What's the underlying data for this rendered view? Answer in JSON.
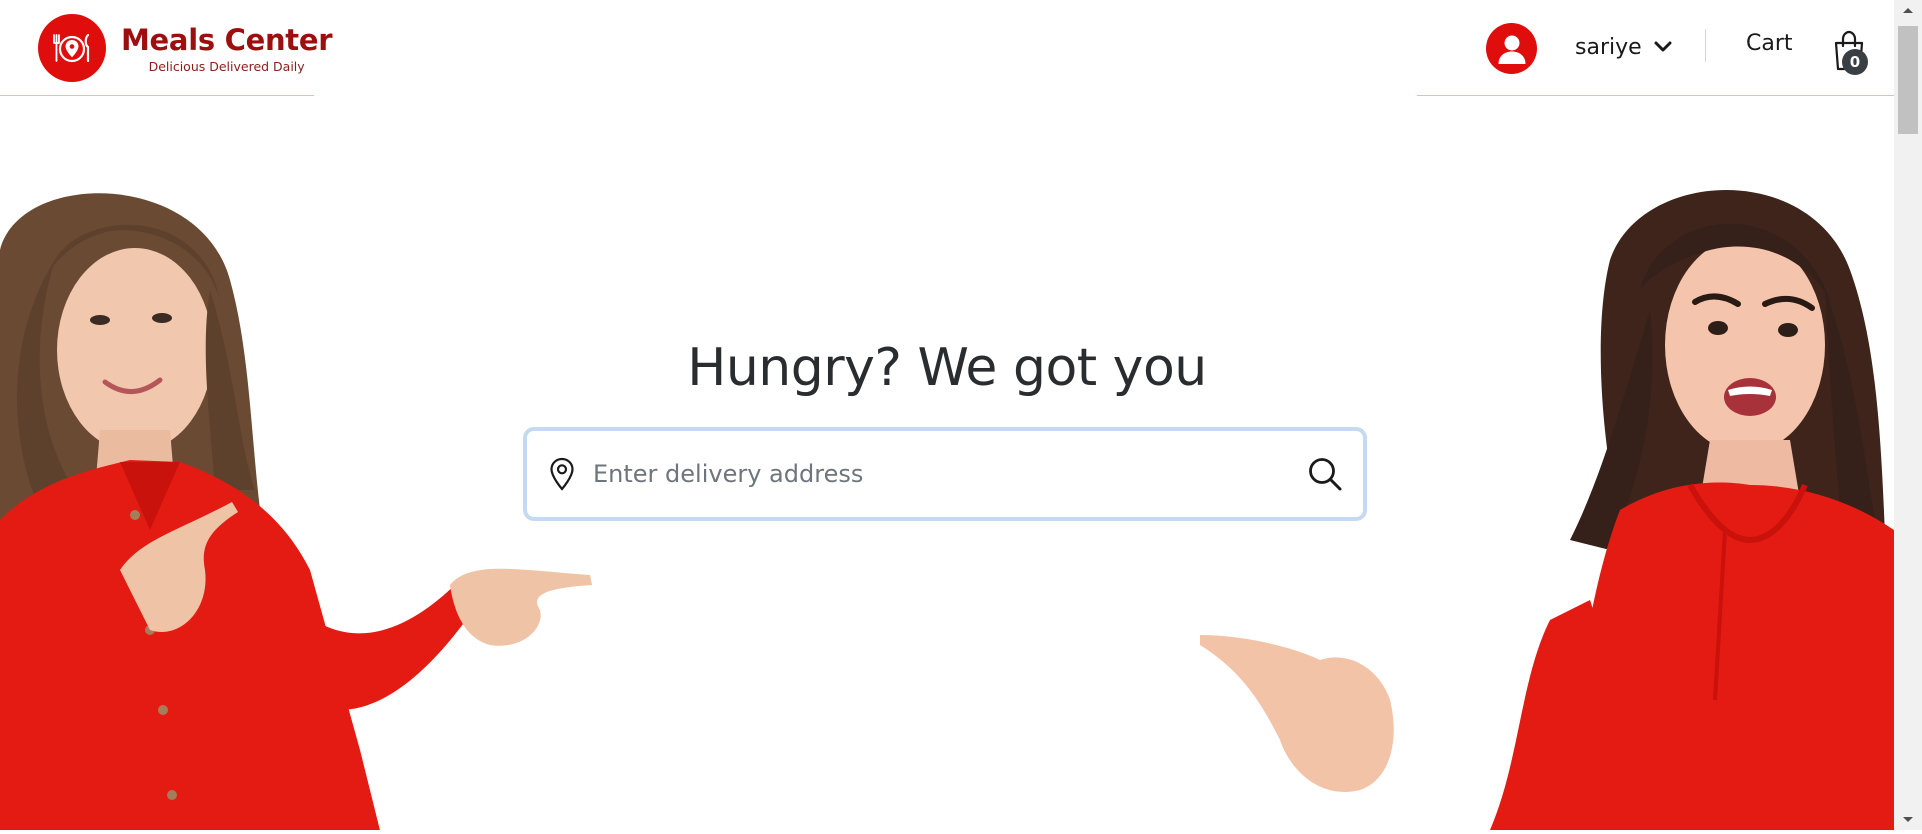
{
  "brand": {
    "name": "Meals Center",
    "tagline": "Delicious Delivered Daily",
    "color": "#e00d0d",
    "text_color": "#9d0f0f"
  },
  "header": {
    "user_name": "sariye",
    "cart_label": "Cart",
    "cart_count": "0",
    "icons": [
      "user-avatar-icon",
      "chevron-down-icon",
      "shopping-bag-icon"
    ]
  },
  "hero": {
    "title": "Hungry? We got you",
    "search": {
      "placeholder": "Enter delivery address",
      "value": "",
      "icons": [
        "location-pin-icon",
        "search-icon"
      ]
    }
  },
  "theme": {
    "accent": "#e00d0d",
    "search_border": "#c3daf1",
    "divider": "#f0b6b6"
  }
}
